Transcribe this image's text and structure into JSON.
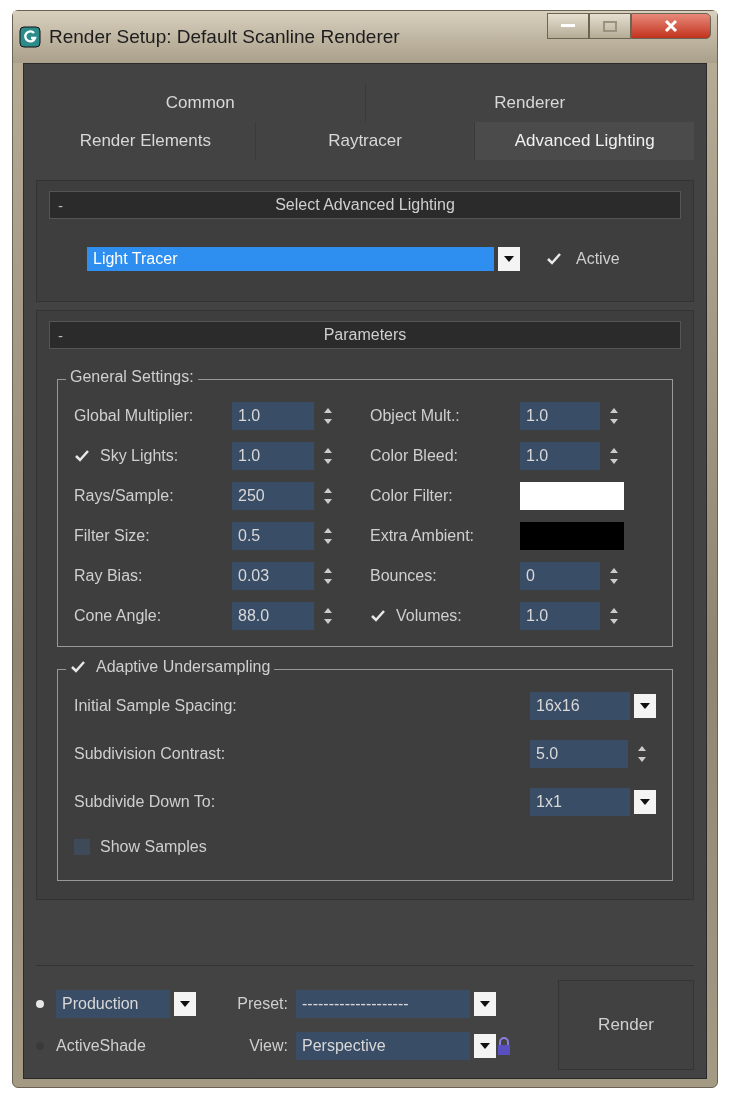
{
  "window": {
    "title": "Render Setup: Default Scanline Renderer"
  },
  "tabs": [
    [
      {
        "label": "Common",
        "selected": false
      },
      {
        "label": "Renderer",
        "selected": false
      }
    ],
    [
      {
        "label": "Render Elements",
        "selected": false
      },
      {
        "label": "Raytracer",
        "selected": false
      },
      {
        "label": "Advanced Lighting",
        "selected": true
      }
    ]
  ],
  "select_rollout": {
    "collapse": "-",
    "title": "Select Advanced Lighting",
    "dropdown": "Light Tracer",
    "active": {
      "label": "Active",
      "checked": true
    }
  },
  "parameters_rollout": {
    "collapse": "-",
    "title": "Parameters",
    "general_settings": {
      "title": "General Settings:",
      "left": [
        {
          "kind": "spinner",
          "label": "Global Multiplier:",
          "value": "1.0"
        },
        {
          "kind": "check_spinner",
          "label": "Sky Lights:",
          "value": "1.0",
          "checked": true
        },
        {
          "kind": "spinner",
          "label": "Rays/Sample:",
          "value": "250"
        },
        {
          "kind": "spinner",
          "label": "Filter Size:",
          "value": "0.5"
        },
        {
          "kind": "spinner",
          "label": "Ray Bias:",
          "value": "0.03"
        },
        {
          "kind": "spinner",
          "label": "Cone Angle:",
          "value": "88.0"
        }
      ],
      "right": [
        {
          "kind": "spinner",
          "label": "Object Mult.:",
          "value": "1.0"
        },
        {
          "kind": "spinner",
          "label": "Color Bleed:",
          "value": "1.0"
        },
        {
          "kind": "swatch",
          "label": "Color Filter:",
          "color": "#ffffff"
        },
        {
          "kind": "swatch",
          "label": "Extra Ambient:",
          "color": "#000000"
        },
        {
          "kind": "spinner",
          "label": "Bounces:",
          "value": "0"
        },
        {
          "kind": "check_spinner",
          "label": "Volumes:",
          "value": "1.0",
          "checked": true
        }
      ]
    },
    "adaptive_undersampling": {
      "title": "Adaptive Undersampling",
      "checked": true,
      "rows": [
        {
          "kind": "dropdown",
          "label": "Initial Sample Spacing:",
          "value": "16x16"
        },
        {
          "kind": "spinner",
          "label": "Subdivision Contrast:",
          "value": "5.0"
        },
        {
          "kind": "dropdown",
          "label": "Subdivide Down To:",
          "value": "1x1"
        }
      ],
      "show_samples": {
        "label": "Show Samples",
        "checked": false
      }
    }
  },
  "bottom": {
    "modes": [
      {
        "kind": "dropdown",
        "label": "Production",
        "selected": true
      },
      {
        "kind": "label",
        "label": "ActiveShade",
        "selected": false
      }
    ],
    "preset": {
      "label": "Preset:",
      "value": "--------------------"
    },
    "view": {
      "label": "View:",
      "value": "Perspective"
    },
    "render_button": "Render"
  }
}
